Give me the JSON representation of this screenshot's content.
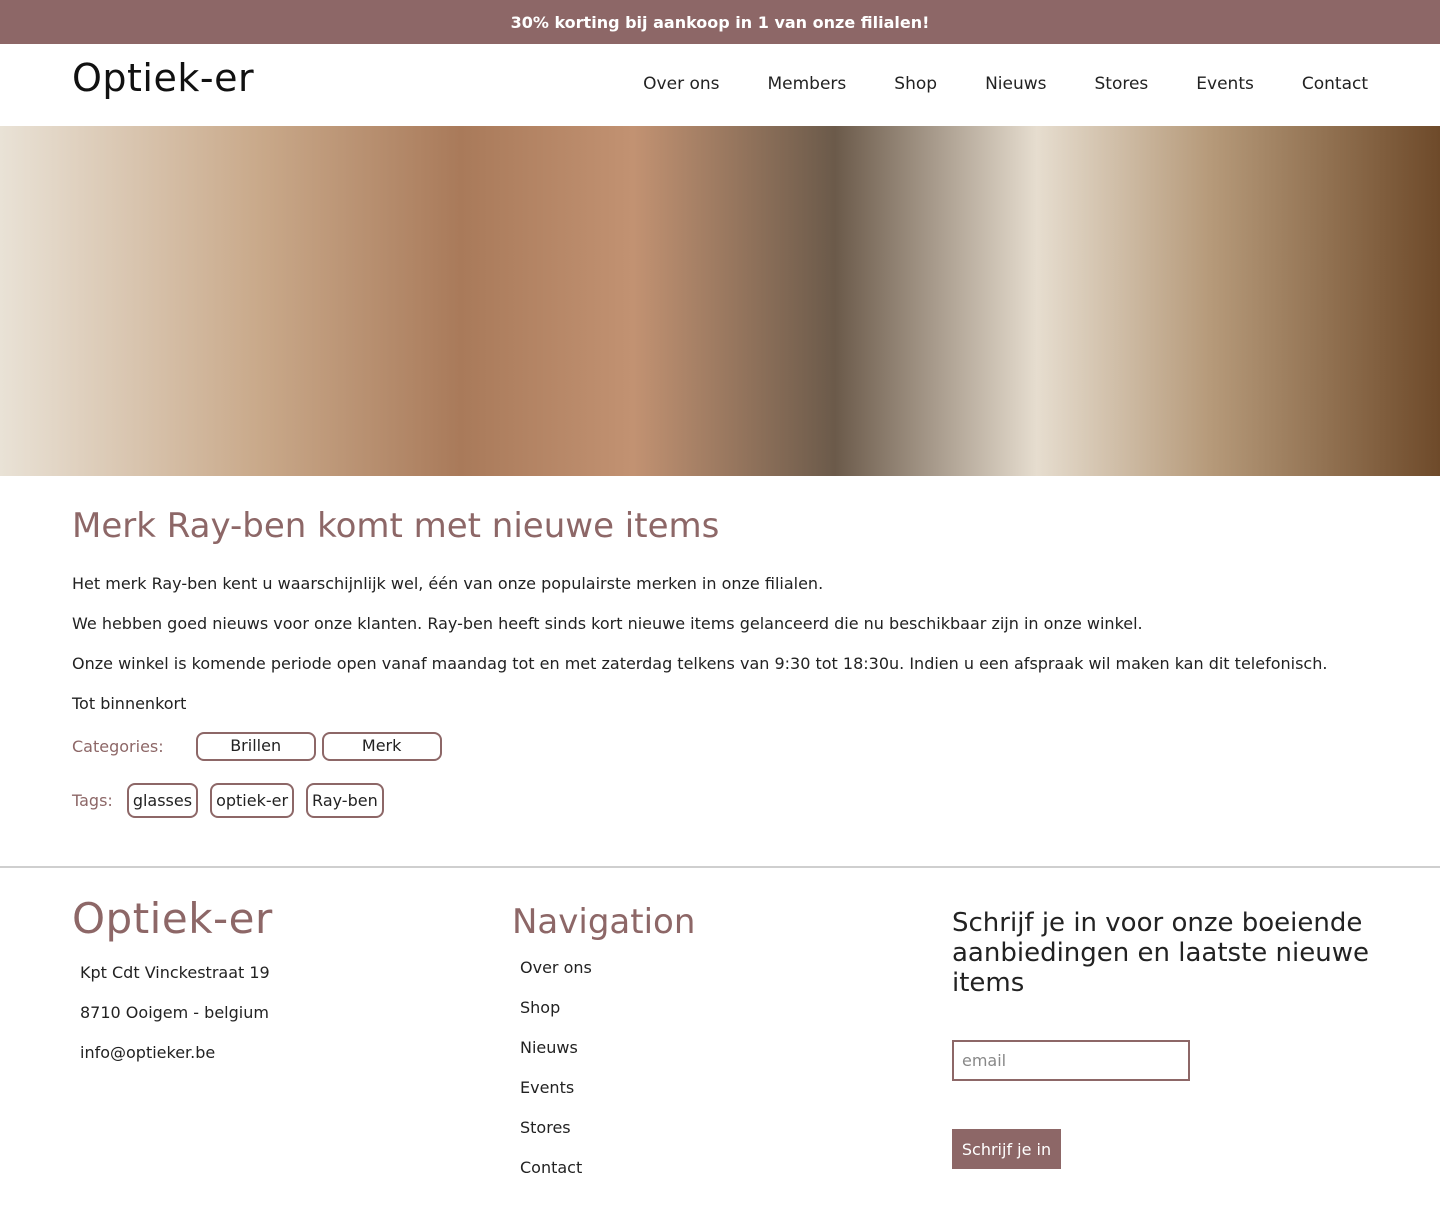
{
  "promo": {
    "text": "30% korting bij aankoop in 1 van onze filialen!"
  },
  "header": {
    "logo": "Optiek-er",
    "nav": [
      {
        "label": "Over ons"
      },
      {
        "label": "Members"
      },
      {
        "label": "Shop"
      },
      {
        "label": "Nieuws"
      },
      {
        "label": "Stores"
      },
      {
        "label": "Events"
      },
      {
        "label": "Contact"
      }
    ]
  },
  "article": {
    "title": "Merk Ray-ben komt met nieuwe items",
    "paragraphs": [
      "Het merk Ray-ben kent u waarschijnlijk wel, één van onze populairste merken in onze filialen.",
      "We hebben goed nieuws voor onze klanten. Ray-ben heeft sinds kort nieuwe items gelanceerd die nu beschikbaar zijn in onze winkel.",
      "Onze winkel is komende periode open vanaf maandag tot en met zaterdag telkens van 9:30 tot 18:30u. Indien u een afspraak wil maken kan dit telefonisch.",
      "Tot binnenkort"
    ],
    "categories_label": "Categories:",
    "categories": [
      "Brillen",
      "Merk"
    ],
    "tags_label": "Tags:",
    "tags": [
      "glasses",
      "optiek-er",
      "Ray-ben"
    ]
  },
  "footer": {
    "logo": "Optiek-er",
    "address": [
      "Kpt Cdt Vinckestraat 19",
      "8710 Ooigem - belgium",
      "info@optieker.be"
    ],
    "nav_title": "Navigation",
    "nav": [
      {
        "label": "Over ons"
      },
      {
        "label": "Shop"
      },
      {
        "label": "Nieuws"
      },
      {
        "label": "Events"
      },
      {
        "label": "Stores"
      },
      {
        "label": "Contact"
      }
    ],
    "newsletter_title": "Schrijf je in voor onze boeiende aanbiedingen en laatste nieuwe items",
    "email_placeholder": "email",
    "subscribe_label": "Schrijf je in"
  },
  "colors": {
    "accent": "#8d6767",
    "text": "#222222",
    "background": "#ffffff"
  }
}
